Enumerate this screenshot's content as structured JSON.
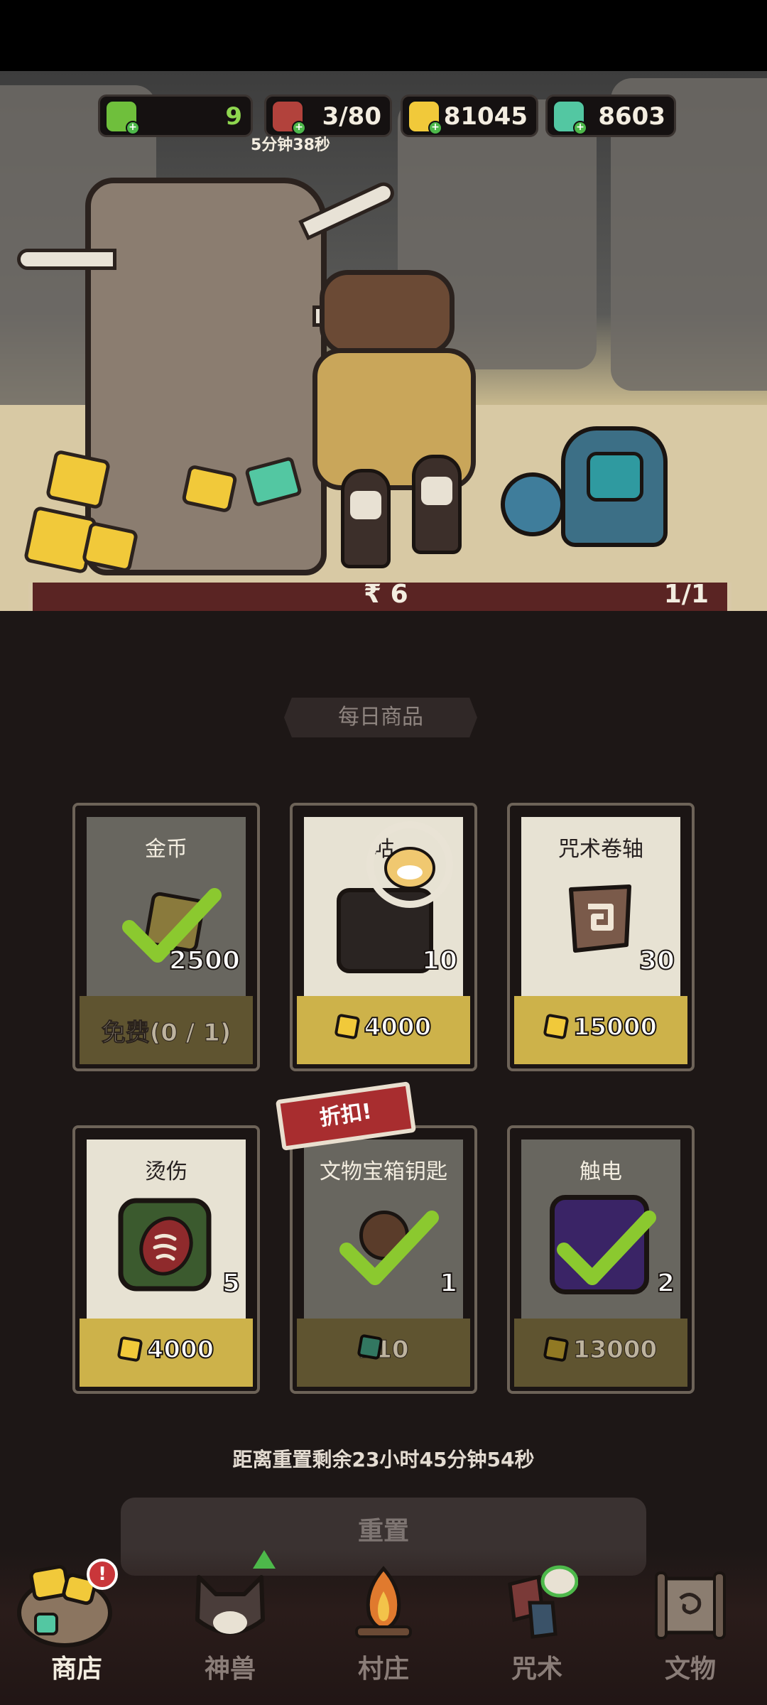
{
  "resources": [
    {
      "name": "green-essence",
      "value": "9",
      "color": "#6fbf3c"
    },
    {
      "name": "meat",
      "value": "3/80",
      "color": "#b2423c"
    },
    {
      "name": "gold",
      "value": "81045",
      "color": "#f1c93a"
    },
    {
      "name": "gem",
      "value": "8603",
      "color": "#53c7a2"
    }
  ],
  "energy_timer": "5分钟38秒",
  "scene_bar": {
    "left": "₹ 6",
    "right": "1/1"
  },
  "section_title": "每日商品",
  "cards": [
    {
      "name": "金币",
      "qty": "2500",
      "price": "免费(0 / 1)",
      "currency": "none",
      "purchased": true
    },
    {
      "name": "咕",
      "qty": "10",
      "price": "4000",
      "currency": "gold",
      "purchased": false
    },
    {
      "name": "咒术卷轴",
      "qty": "30",
      "price": "15000",
      "currency": "gold",
      "purchased": false
    },
    {
      "name": "烫伤",
      "qty": "5",
      "price": "4000",
      "currency": "gold",
      "purchased": false
    },
    {
      "name": "文物宝箱钥匙",
      "qty": "1",
      "price": "210",
      "currency": "gem",
      "purchased": true
    },
    {
      "name": "触电",
      "qty": "2",
      "price": "13000",
      "currency": "gold",
      "purchased": true
    }
  ],
  "discount_label": "折扣!",
  "reset_timer": "距离重置剩余23小时45分钟54秒",
  "reset_button": "重置",
  "nav": [
    {
      "label": "商店",
      "active": true,
      "icon": "shop-icon"
    },
    {
      "label": "神兽",
      "active": false,
      "icon": "beast-icon"
    },
    {
      "label": "村庄",
      "active": false,
      "icon": "campfire-icon"
    },
    {
      "label": "咒术",
      "active": false,
      "icon": "spell-icon"
    },
    {
      "label": "文物",
      "active": false,
      "icon": "scroll-icon"
    }
  ],
  "nav_badge": "!"
}
